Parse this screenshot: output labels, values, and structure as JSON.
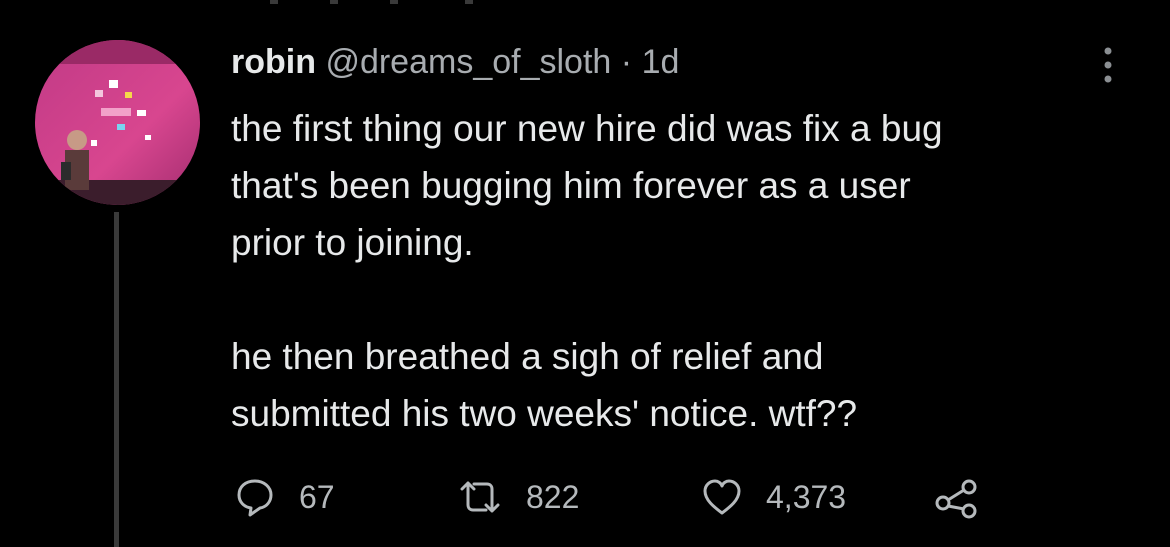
{
  "tweet": {
    "author": {
      "name": "robin",
      "handle": "@dreams_of_sloth",
      "separator": "·",
      "time": "1d"
    },
    "body": {
      "line1": "the first thing our new hire did was fix a bug",
      "line2": "that's been bugging him forever as a user",
      "line3": "prior to joining.",
      "line4": "he then breathed a sigh of relief and",
      "line5": "submitted his two weeks' notice. wtf??"
    },
    "actions": {
      "replies": "67",
      "retweets": "822",
      "likes": "4,373"
    },
    "icons": {
      "reply": "reply-icon",
      "retweet": "retweet-icon",
      "like": "heart-icon",
      "share": "share-icon",
      "more": "more-options-icon"
    }
  },
  "colors": {
    "background": "#000000",
    "text": "#e7e9ea",
    "muted": "#a8acb0",
    "avatar_pink": "#d23e8a",
    "thread_line": "#3a3a3a"
  }
}
